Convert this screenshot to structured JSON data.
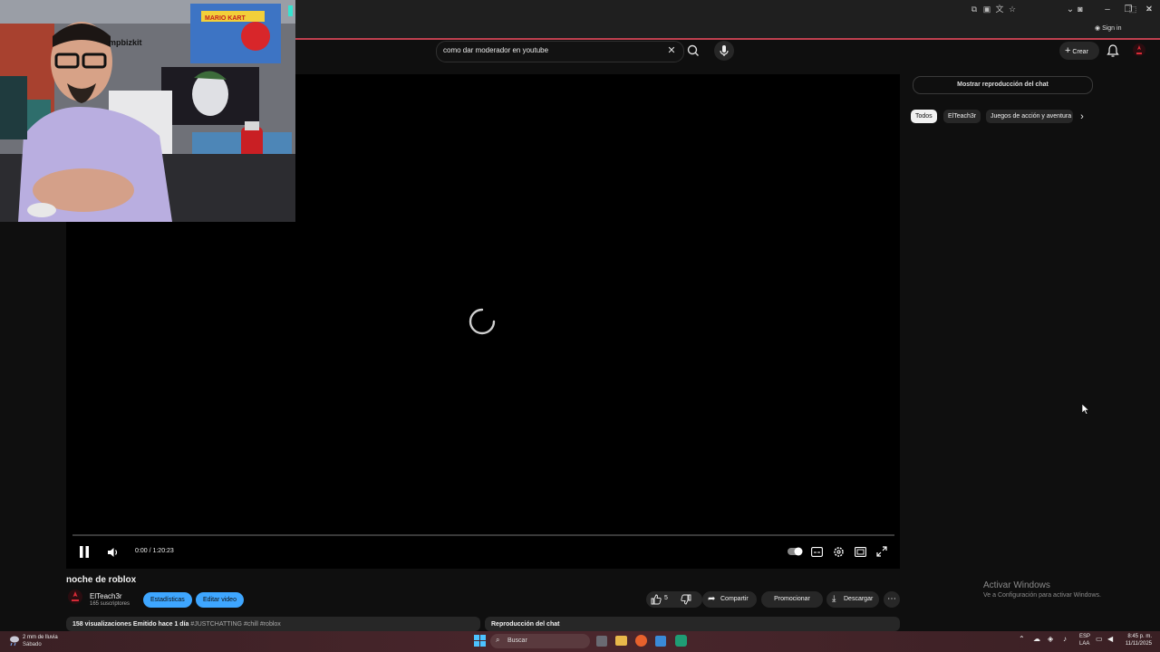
{
  "search": {
    "query": "como dar moderador en youtube"
  },
  "header": {
    "create_label": "Crear",
    "signin_label": "Sign in"
  },
  "player": {
    "time_display": "0:00 / 1:20:23",
    "progress": 0
  },
  "webcam": {
    "label_text": "mpbizkit",
    "poster_text": "MARIO KART"
  },
  "sidebar": {
    "chat_replay_button": "Mostrar reproducción del chat",
    "chips": [
      {
        "label": "Todos",
        "active": true
      },
      {
        "label": "ElTeach3r",
        "active": false
      },
      {
        "label": "Juegos de acción y aventura",
        "active": false
      }
    ]
  },
  "video": {
    "title": "noche de roblox",
    "channel_name": "ElTeach3r",
    "subscribers": "165 suscriptores",
    "stats_button": "Estadísticas",
    "edit_button": "Editar video",
    "like_count": "5",
    "share_label": "Compartir",
    "promote_label": "Promocionar",
    "download_label": "Descargar",
    "description_meta": "158 visualizaciones  Emitido hace 1 día",
    "description_tags": "#JUSTCHATTING #chill #roblox",
    "chat_replay_title": "Reproducción del chat"
  },
  "watermark": {
    "line1": "Activar Windows",
    "line2": "Ve a Configuración para activar Windows."
  },
  "taskbar": {
    "weather_line1": "2 mm de lluvia",
    "weather_line2": "Sábado",
    "search_placeholder": "Buscar",
    "lang_line1": "ESP",
    "lang_line2": "LAA",
    "time": "8:45 p. m.",
    "date": "11/11/2025"
  },
  "colors": {
    "accent_red": "#c0404f",
    "blue_pill": "#3ea6ff",
    "background": "#0f0f0f"
  }
}
